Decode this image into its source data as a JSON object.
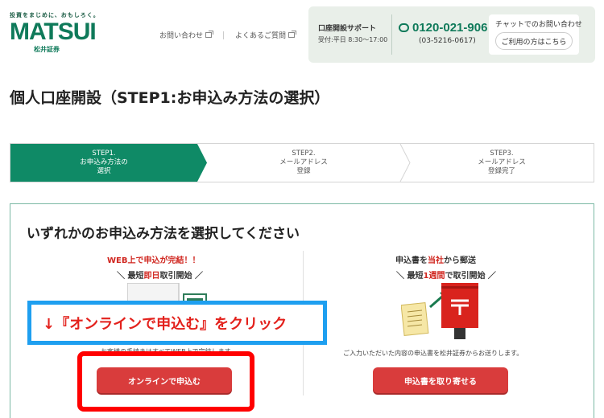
{
  "header": {
    "logo_tagline": "投資をまじめに、おもしろく。",
    "logo_wordmark": "MATSUI",
    "logo_sub": "松井証券",
    "links": [
      {
        "label": "お問い合わせ",
        "icon": "external-link-icon"
      },
      {
        "label": "よくあるご質問",
        "icon": "external-link-icon"
      }
    ],
    "support": {
      "title": "口座開設サポート",
      "hours": "受付:平日 8:30～17:00",
      "phone_icon": "free-dial-icon",
      "phone": "0120-021-906",
      "phone_alt": "(03-5216-0617)",
      "chat_title": "チャットでのお問い合わせ",
      "chat_button": "ご利用の方はこちら"
    }
  },
  "page_title": "個人口座開設（STEP1:お申込み方法の選択）",
  "steps": [
    {
      "label_1": "STEP1.",
      "label_2": "お申込み方法の",
      "label_3": "選択",
      "active": true
    },
    {
      "label_1": "STEP2.",
      "label_2": "メールアドレス",
      "label_3": "登録",
      "active": false
    },
    {
      "label_1": "STEP3.",
      "label_2": "メールアドレス",
      "label_3": "登録完了",
      "active": false
    }
  ],
  "main": {
    "heading": "いずれかのお申込み方法を選択してください",
    "online": {
      "headline": "WEB上で申込が完結！！",
      "sub_prefix": "＼ 最短",
      "sub_highlight": "即日",
      "sub_suffix": "取引開始 ／",
      "description": "お客様の手続きはすべてWEB上で完結します。",
      "button": "オンラインで申込む"
    },
    "mail": {
      "headline_prefix": "申込書を",
      "headline_highlight": "当社",
      "headline_suffix": "から郵送",
      "sub_prefix": "＼ 最短",
      "sub_highlight": "1週間",
      "sub_suffix": "で取引開始 ／",
      "description": "ご入力いただいた内容の申込書を松井証券からお送りします。",
      "button": "申込書を取り寄せる"
    }
  },
  "annotation": {
    "callout": "↓『オンラインで申込む』をクリック"
  },
  "colors": {
    "brand_green": "#0f7a5a",
    "accent_red": "#d93c3c",
    "callout_blue": "#1e9ff0",
    "highlight_red": "#ff0000"
  }
}
